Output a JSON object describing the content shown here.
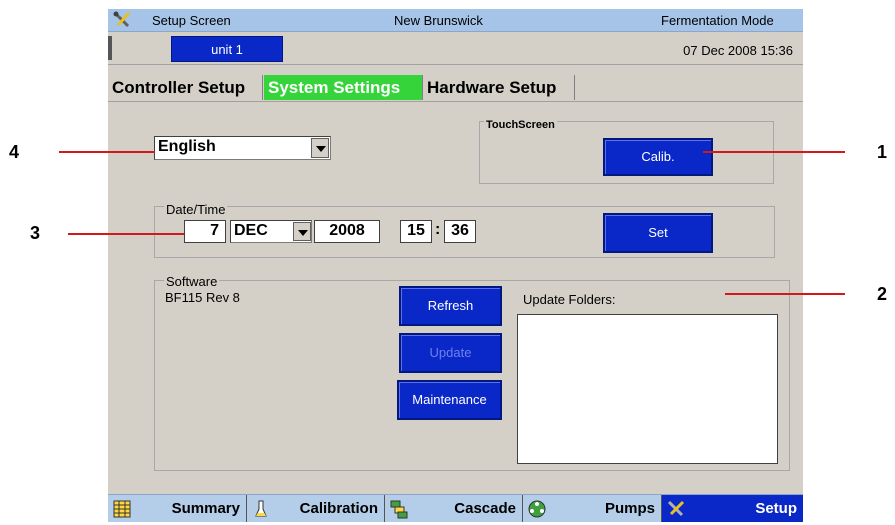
{
  "titlebar": {
    "screen_name": "Setup Screen",
    "company": "New Brunswick",
    "mode": "Fermentation Mode",
    "icon": "tools-icon"
  },
  "unitbar": {
    "unit_label": "unit 1",
    "status_datetime": "07 Dec 2008  15:36"
  },
  "tabs": [
    {
      "label": "Controller Setup",
      "active": false
    },
    {
      "label": "System Settings",
      "active": true
    },
    {
      "label": "Hardware Setup",
      "active": false
    }
  ],
  "language": {
    "value": "English"
  },
  "touchscreen": {
    "group_label": "TouchScreen",
    "calib_label": "Calib."
  },
  "datetime": {
    "group_label": "Date/Time",
    "day": "7",
    "month": "DEC",
    "year": "2008",
    "hour": "15",
    "separator": ":",
    "minute": "36",
    "set_label": "Set"
  },
  "software": {
    "group_label": "Software",
    "version": "BF115 Rev 8",
    "refresh_label": "Refresh",
    "update_label": "Update",
    "maintenance_label": "Maintenance",
    "folders_label": "Update Folders:"
  },
  "bottomnav": [
    {
      "label": "Summary",
      "icon": "grid-icon",
      "active": false
    },
    {
      "label": "Calibration",
      "icon": "probe-icon",
      "active": false
    },
    {
      "label": "Cascade",
      "icon": "cascade-icon",
      "active": false
    },
    {
      "label": "Pumps",
      "icon": "pump-icon",
      "active": false
    },
    {
      "label": "Setup",
      "icon": "tools-icon",
      "active": true
    }
  ],
  "callouts": [
    "1",
    "2",
    "3",
    "4"
  ],
  "colors": {
    "panel": "#d4d0c8",
    "button_blue": "#0a28c8",
    "active_tab": "#35d43a",
    "titlebar": "#a6c4e8",
    "callout_red": "#d21818"
  }
}
